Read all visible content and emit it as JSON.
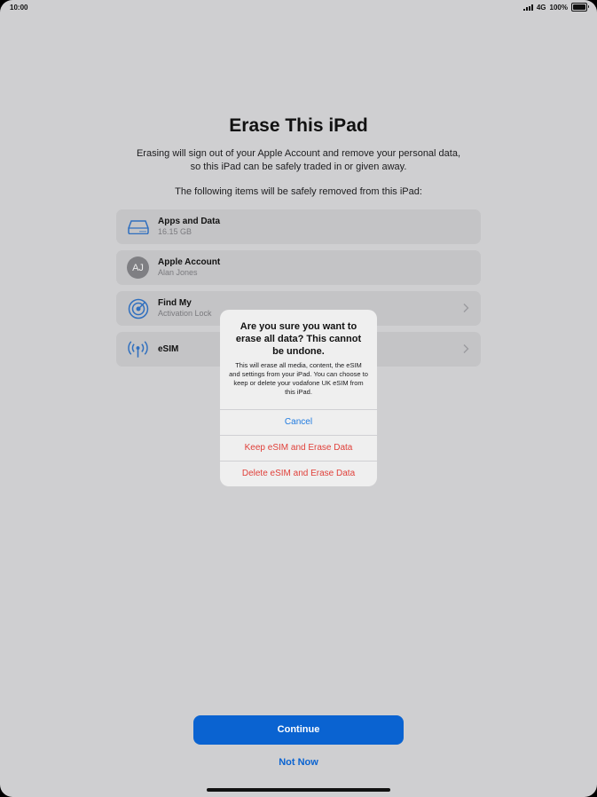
{
  "status_bar": {
    "time": "10:00",
    "network": "4G",
    "battery": "100%"
  },
  "header": {
    "title": "Erase This iPad",
    "description": "Erasing will sign out of your Apple Account and remove your personal data, so this iPad can be safely traded in or given away.",
    "items_intro": "The following items will be safely removed from this iPad:"
  },
  "items": [
    {
      "icon": "drive-icon",
      "title": "Apps and Data",
      "subtitle": "16.15 GB"
    },
    {
      "icon": "avatar",
      "avatar_initials": "AJ",
      "title": "Apple Account",
      "subtitle": "Alan Jones"
    },
    {
      "icon": "find-my-icon",
      "title": "Find My",
      "subtitle": "Activation Lock"
    },
    {
      "icon": "antenna-icon",
      "title": "eSIM"
    }
  ],
  "alert": {
    "title": "Are you sure you want to erase all data? This cannot be undone.",
    "message": "This will erase all media, content, the eSIM and settings from your iPad. You can choose to keep or delete your vodafone UK eSIM from this iPad.",
    "cancel_label": "Cancel",
    "keep_label": "Keep eSIM and Erase Data",
    "delete_label": "Delete eSIM and Erase Data"
  },
  "footer": {
    "continue_label": "Continue",
    "not_now_label": "Not Now"
  },
  "colors": {
    "accent": "#0a63d1",
    "destructive": "#e0403a",
    "icon_blue": "#2f6fbf",
    "alert_link": "#1f7ae0"
  }
}
